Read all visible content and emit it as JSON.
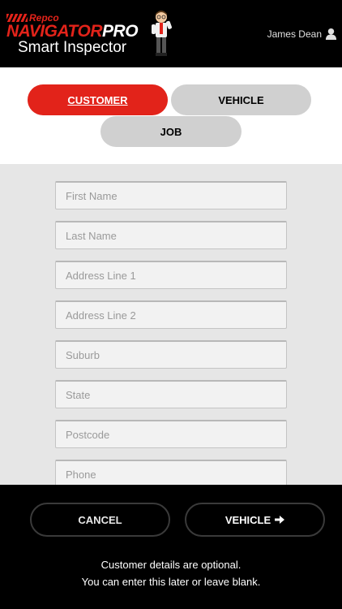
{
  "header": {
    "brand_small": "Repco",
    "brand_nav": "NAVIGAT",
    "brand_o": "O",
    "brand_r": "R",
    "brand_pro": "PRO",
    "app_name": "Smart Inspector",
    "user_name": "James Dean"
  },
  "tabs": {
    "customer": "CUSTOMER",
    "vehicle": "VEHICLE",
    "job": "JOB"
  },
  "form": {
    "fields": [
      {
        "key": "first_name",
        "placeholder": "First Name",
        "value": ""
      },
      {
        "key": "last_name",
        "placeholder": "Last Name",
        "value": ""
      },
      {
        "key": "address1",
        "placeholder": "Address Line 1",
        "value": ""
      },
      {
        "key": "address2",
        "placeholder": "Address Line 2",
        "value": ""
      },
      {
        "key": "suburb",
        "placeholder": "Suburb",
        "value": ""
      },
      {
        "key": "state",
        "placeholder": "State",
        "value": ""
      },
      {
        "key": "postcode",
        "placeholder": "Postcode",
        "value": ""
      },
      {
        "key": "phone",
        "placeholder": "Phone",
        "value": ""
      }
    ]
  },
  "footer": {
    "cancel_label": "CANCEL",
    "next_label": "VEHICLE",
    "note_line1": "Customer details are optional.",
    "note_line2": "You can enter this later or leave blank."
  },
  "colors": {
    "accent": "#e2231a",
    "tab_inactive": "#d0d0d0",
    "form_bg": "#e6e6e6"
  }
}
